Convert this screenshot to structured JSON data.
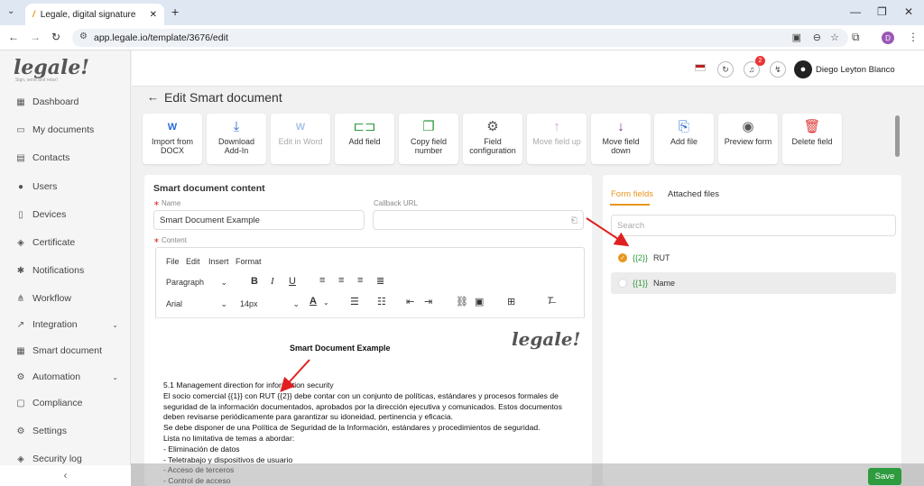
{
  "browser": {
    "tab_title": "Legale, digital signature",
    "new_tab": "+",
    "url": "app.legale.io/template/3676/edit",
    "profile_initial": "D"
  },
  "brand": {
    "logo": "legale!",
    "tagline": "Sign, send and relax!"
  },
  "sidebar": {
    "items": [
      {
        "label": "Dashboard",
        "icon": "dashboard-icon",
        "glyph": "▦"
      },
      {
        "label": "My documents",
        "icon": "folder-icon",
        "glyph": "▭"
      },
      {
        "label": "Contacts",
        "icon": "contacts-icon",
        "glyph": "▤"
      },
      {
        "label": "Users",
        "icon": "user-icon",
        "glyph": "●"
      },
      {
        "label": "Devices",
        "icon": "device-icon",
        "glyph": "▯"
      },
      {
        "label": "Certificate",
        "icon": "shield-icon",
        "glyph": "◈"
      },
      {
        "label": "Notifications",
        "icon": "bell-icon",
        "glyph": "✱"
      },
      {
        "label": "Workflow",
        "icon": "workflow-icon",
        "glyph": "⋔"
      },
      {
        "label": "Integration",
        "icon": "integration-icon",
        "glyph": "↗",
        "expandable": true
      },
      {
        "label": "Smart document",
        "icon": "grid-icon",
        "glyph": "▦"
      },
      {
        "label": "Automation",
        "icon": "gear-icon",
        "glyph": "⚙",
        "expandable": true
      },
      {
        "label": "Compliance",
        "icon": "compliance-icon",
        "glyph": "▢"
      },
      {
        "label": "Settings",
        "icon": "settings-icon",
        "glyph": "⚙"
      },
      {
        "label": "Security log",
        "icon": "shield-check-icon",
        "glyph": "◈"
      }
    ],
    "collapse_glyph": "‹"
  },
  "header": {
    "notification_count": "2",
    "user_name": "Diego Leyton Blanco"
  },
  "page": {
    "back_glyph": "←",
    "title": "Edit Smart document"
  },
  "toolbar": [
    {
      "label": "Import from DOCX",
      "icon": "word-icon",
      "glyph": "W",
      "color": "#2b6cd8",
      "disabled": false
    },
    {
      "label": "Download Add-In",
      "icon": "download-icon",
      "glyph": "⤓",
      "color": "#2b6cd8",
      "disabled": false
    },
    {
      "label": "Edit in Word",
      "icon": "word-icon",
      "glyph": "W",
      "color": "#a9c3ea",
      "disabled": true
    },
    {
      "label": "Add field",
      "icon": "add-field-icon",
      "glyph": "⊏⊐",
      "color": "#2e9b3e",
      "disabled": false
    },
    {
      "label": "Copy field number",
      "icon": "copy-icon",
      "glyph": "❐",
      "color": "#2e9b3e",
      "disabled": false
    },
    {
      "label": "Field configuration",
      "icon": "gear-icon",
      "glyph": "⚙",
      "color": "#555",
      "disabled": false
    },
    {
      "label": "Move field up",
      "icon": "arrow-up-icon",
      "glyph": "↑",
      "color": "#c9a6d8",
      "disabled": true
    },
    {
      "label": "Move field down",
      "icon": "arrow-down-icon",
      "glyph": "↓",
      "color": "#7a2a9a",
      "disabled": false
    },
    {
      "label": "Add file",
      "icon": "add-file-icon",
      "glyph": "⎘",
      "color": "#2b6cd8",
      "disabled": false
    },
    {
      "label": "Preview form",
      "icon": "eye-icon",
      "glyph": "◉",
      "color": "#555",
      "disabled": false
    },
    {
      "label": "Delete field",
      "icon": "trash-icon",
      "glyph": "🗑",
      "color": "#d33",
      "disabled": false
    }
  ],
  "content": {
    "heading": "Smart document content",
    "name_label": "Name",
    "name_value": "Smart Document Example",
    "callback_label": "Callback URL",
    "callback_value": "",
    "content_label": "Content"
  },
  "editor": {
    "menus": [
      "File",
      "Edit",
      "Insert",
      "Format"
    ],
    "block_format": "Paragraph",
    "font_family": "Arial",
    "font_size": "14px",
    "doc_title": "Smart Document Example",
    "doc_logo": "legale!",
    "lines": [
      "5.1 Management direction for information security",
      "El socio comercial {{1}} con RUT {{2}} debe contar con un conjunto de políticas, estándares y procesos formales de",
      "seguridad de la información documentados, aprobados por la dirección ejecutiva y comunicados. Estos documentos",
      "deben revisarse periódicamente para garantizar su idoneidad, pertinencia y eficacia.",
      "Se debe disponer de una Política de Seguridad de la Información, estándares y procedimientos de seguridad.",
      "Lista no limitativa de temas a abordar:",
      "- Eliminación de datos",
      "- Teletrabajo y dispositivos de usuario",
      "- Acceso de terceros",
      "- Control de acceso"
    ]
  },
  "panel": {
    "tabs": [
      "Form fields",
      "Attached files"
    ],
    "active_tab": "Form fields",
    "search_placeholder": "Search",
    "fields": [
      {
        "code": "{{2}}",
        "name": "RUT",
        "checked": true
      },
      {
        "code": "{{1}}",
        "name": "Name",
        "checked": false
      }
    ]
  },
  "actions": {
    "save": "Save"
  },
  "colors": {
    "accent": "#e8961e",
    "green": "#2e9b3e",
    "arrow": "#e02020"
  }
}
